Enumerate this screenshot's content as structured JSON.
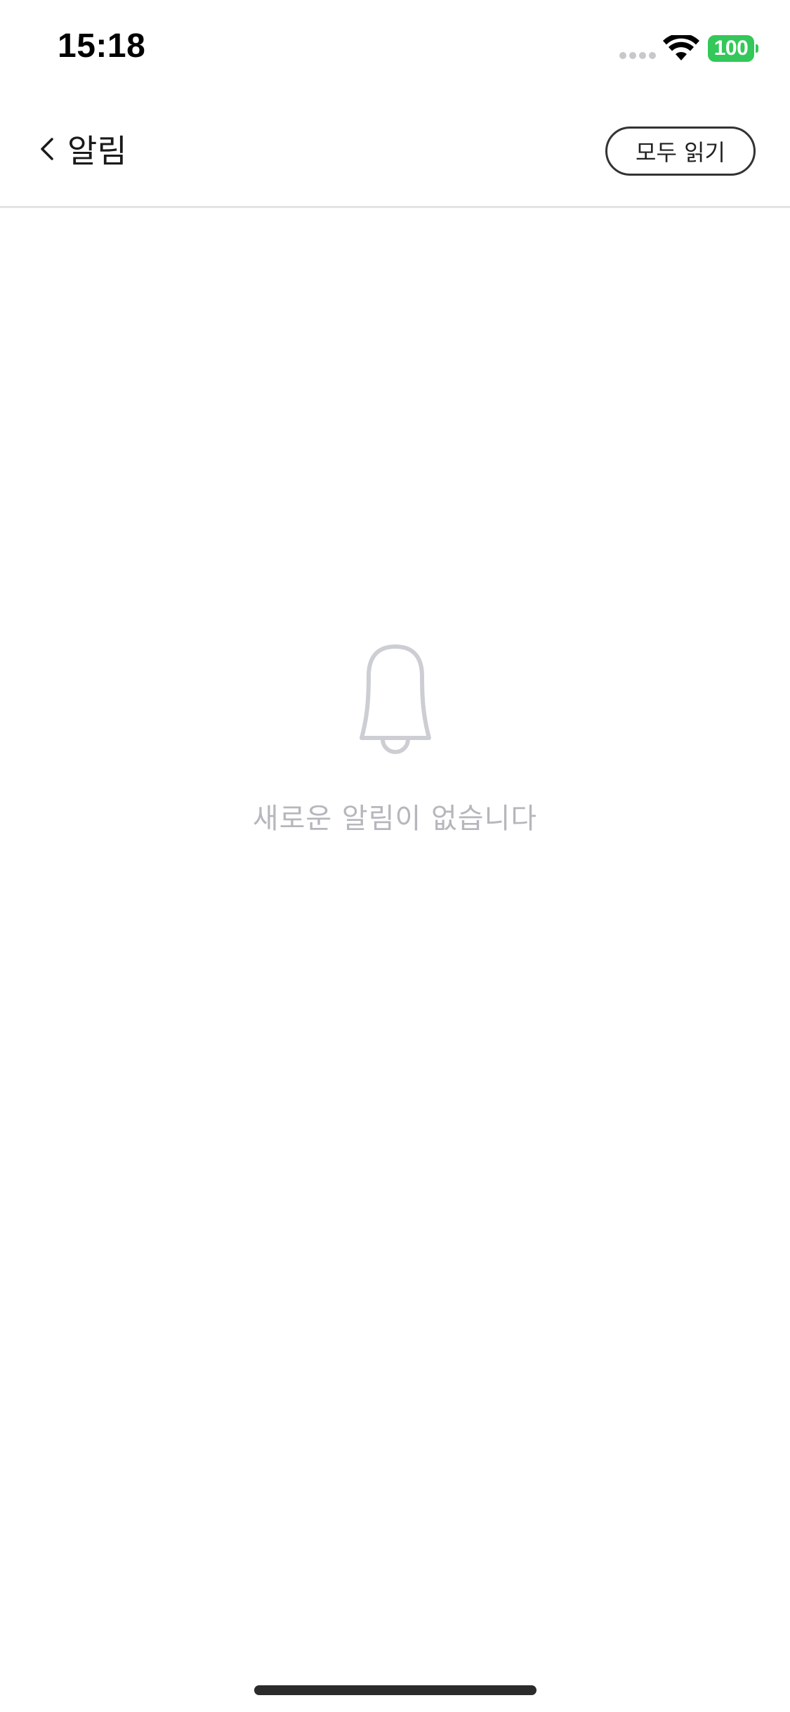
{
  "status_bar": {
    "time": "15:18",
    "battery_level": "100",
    "battery_color": "#34c759",
    "icons": [
      "signal-dots",
      "wifi-icon",
      "battery-icon"
    ]
  },
  "nav": {
    "back_icon": "chevron-left-icon",
    "title": "알림",
    "read_all_label": "모두 읽기"
  },
  "empty_state": {
    "icon": "bell-icon",
    "message": "새로운 알림이 없습니다",
    "icon_color": "#ccced3",
    "text_color": "#b5b7bc"
  }
}
